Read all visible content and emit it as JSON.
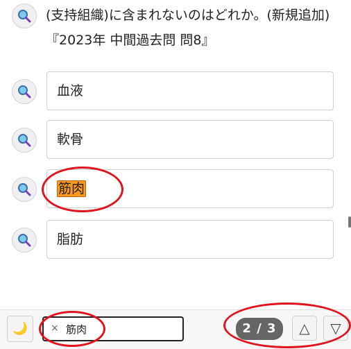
{
  "question": {
    "text": "(支持組織)に含まれないのはどれか。(新規追加)『2023年 中間過去問 問8』"
  },
  "options": [
    {
      "label": "血液",
      "highlighted": false
    },
    {
      "label": "軟骨",
      "highlighted": false
    },
    {
      "label": "筋肉",
      "highlighted": true
    },
    {
      "label": "脂肪",
      "highlighted": false
    }
  ],
  "icons": {
    "option_icon": "magnifier-icon",
    "dark_mode_icon": "moon-icon",
    "clear_icon": "close-icon",
    "prev_icon": "triangle-up-icon",
    "next_icon": "triangle-down-icon"
  },
  "search": {
    "clear_label": "×",
    "value": "筋肉"
  },
  "match_counter": {
    "text": "2 / 3"
  },
  "nav": {
    "dark_mode": "🌙",
    "prev": "△",
    "next": "▽"
  },
  "colors": {
    "highlight": "#ff9a1f",
    "annotation": "#e0141e",
    "badge": "#666666"
  }
}
